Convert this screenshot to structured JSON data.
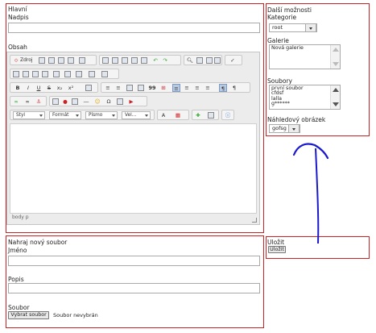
{
  "main": {
    "section_title": "Hlavní",
    "title_label": "Nadpis",
    "title_value": "",
    "content_label": "Obsah",
    "toolbar": {
      "source_label": "Zdroj",
      "combo_style": "Styl",
      "combo_format": "Formát",
      "combo_font": "Písmo",
      "combo_size": "Vel...",
      "bold": "B",
      "italic": "I",
      "underline": "U",
      "strike": "S",
      "subscript": "x₂",
      "superscript": "x²",
      "quote": "99"
    },
    "statusbar": "body  p"
  },
  "upload": {
    "section_title": "Nahraj nový soubor",
    "name_label": "Jméno",
    "name_value": "",
    "description_label": "Popis",
    "description_value": "",
    "file_label": "Soubor",
    "choose_button": "Vybrat soubor",
    "no_file_text": "Soubor nevybrán"
  },
  "options": {
    "section_title": "Další možnosti",
    "category_label": "Kategorie",
    "category_value": "root",
    "gallery_label": "Galerie",
    "gallery_items": [
      "Nová galerie"
    ],
    "files_label": "Soubory",
    "files_items": [
      "první soubor",
      "cfdsf",
      "lalla",
      "g******"
    ],
    "preview_label": "Náhledový obrázek",
    "preview_value": "gofsg"
  },
  "save": {
    "section_title": "Uložit",
    "save_button": "Uložit"
  },
  "colors": {
    "frame_red": "#cc2222",
    "annotation_blue": "#1a1acc"
  }
}
